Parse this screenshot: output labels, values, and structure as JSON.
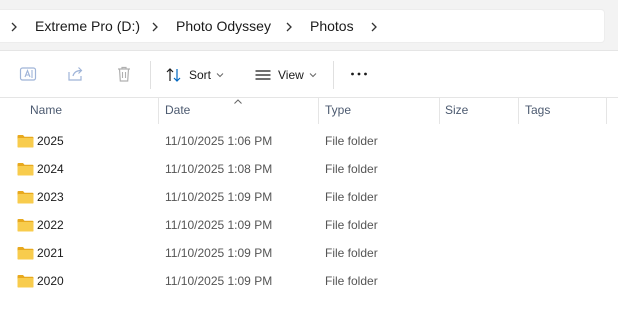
{
  "breadcrumb": {
    "items": [
      "Extreme Pro (D:)",
      "Photo Odyssey",
      "Photos"
    ]
  },
  "toolbar": {
    "sort_label": "Sort",
    "view_label": "View"
  },
  "columns": {
    "name": "Name",
    "date": "Date",
    "type": "Type",
    "size": "Size",
    "tags": "Tags"
  },
  "rows": [
    {
      "name": "2025",
      "date": "11/10/2025 1:06 PM",
      "type": "File folder"
    },
    {
      "name": "2024",
      "date": "11/10/2025 1:08 PM",
      "type": "File folder"
    },
    {
      "name": "2023",
      "date": "11/10/2025 1:09 PM",
      "type": "File folder"
    },
    {
      "name": "2022",
      "date": "11/10/2025 1:09 PM",
      "type": "File folder"
    },
    {
      "name": "2021",
      "date": "11/10/2025 1:09 PM",
      "type": "File folder"
    },
    {
      "name": "2020",
      "date": "11/10/2025 1:09 PM",
      "type": "File folder"
    }
  ],
  "colors": {
    "folder": "#f6c744",
    "header_text": "#4c5a70",
    "accent": "#0067c0"
  }
}
